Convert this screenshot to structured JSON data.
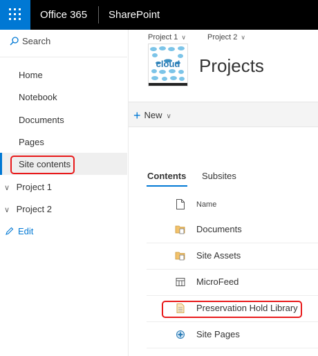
{
  "suite_bar": {
    "app_launcher_icon": "waffle-icon",
    "brand": "Office 365",
    "app_name": "SharePoint",
    "colors": {
      "bar": "#000000",
      "launcher": "#0078d4"
    }
  },
  "left_nav": {
    "search_label": "Search",
    "search_icon": "search-icon",
    "items": [
      {
        "label": "Home"
      },
      {
        "label": "Notebook"
      },
      {
        "label": "Documents"
      },
      {
        "label": "Pages"
      },
      {
        "label": "Site contents",
        "selected": true
      }
    ],
    "tree_items": [
      {
        "label": "Project 1",
        "icon": "chevron-down-icon"
      },
      {
        "label": "Project 2",
        "icon": "chevron-down-icon"
      }
    ],
    "edit_label": "Edit",
    "edit_icon": "pencil-icon"
  },
  "header": {
    "breadcrumbs": [
      {
        "label": "Project 1",
        "icon": "chevron-down-icon"
      },
      {
        "label": "Project 2",
        "icon": "chevron-down-icon"
      }
    ],
    "logo_text": "cloud",
    "site_title": "Projects"
  },
  "command_bar": {
    "new_label": "New",
    "new_icon": "plus-icon",
    "dropdown_icon": "chevron-down-icon"
  },
  "tabs": [
    {
      "label": "Contents",
      "active": true
    },
    {
      "label": "Subsites",
      "active": false
    }
  ],
  "list": {
    "column_name": "Name",
    "header_icon": "document-icon",
    "rows": [
      {
        "name": "Documents",
        "icon": "library-icon"
      },
      {
        "name": "Site Assets",
        "icon": "library-icon"
      },
      {
        "name": "MicroFeed",
        "icon": "list-icon"
      },
      {
        "name": "Preservation Hold Library",
        "icon": "library-page-icon"
      },
      {
        "name": "Site Pages",
        "icon": "pages-icon"
      }
    ]
  },
  "annotation_color": "#e8191a"
}
